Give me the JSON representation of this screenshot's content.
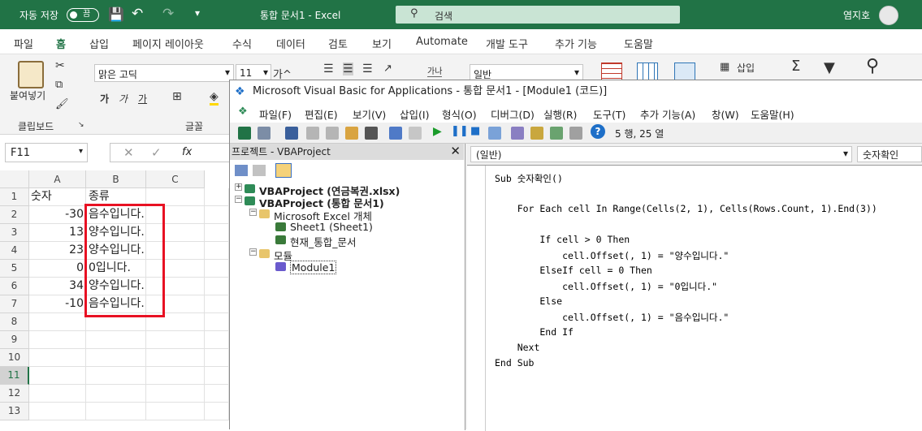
{
  "excel": {
    "autosave_label": "자동 저장",
    "autosave_state": "끔",
    "window_title": "통합 문서1  -  Excel",
    "search_placeholder": "검색",
    "user_name": "염지호",
    "tabs": [
      "파일",
      "홈",
      "삽입",
      "페이지 레이아웃",
      "수식",
      "데이터",
      "검토",
      "보기",
      "Automate",
      "개발 도구",
      "추가 기능",
      "도움말"
    ],
    "active_tab": "홈",
    "ribbon": {
      "paste_label": "붙여넣기",
      "clipboard_group": "클립보드",
      "font_name": "맑은 고딕",
      "font_size": "11",
      "font_group": "글꼴",
      "number_format": "일반",
      "insert_label": "삽입",
      "bold": "가",
      "italic": "가",
      "underline": "가",
      "grow_font": "가^",
      "wrap": "가나"
    },
    "name_box": "F11",
    "formula_fx": "fx",
    "columns": [
      "A",
      "B",
      "C"
    ],
    "rows": [
      {
        "n": "1",
        "a": "숫자",
        "b": "종류"
      },
      {
        "n": "2",
        "a": "-30",
        "b": "음수입니다."
      },
      {
        "n": "3",
        "a": "13",
        "b": "양수입니다."
      },
      {
        "n": "4",
        "a": "23",
        "b": "양수입니다."
      },
      {
        "n": "5",
        "a": "0",
        "b": "0입니다."
      },
      {
        "n": "6",
        "a": "34",
        "b": "양수입니다."
      },
      {
        "n": "7",
        "a": "-10",
        "b": "음수입니다."
      },
      {
        "n": "8",
        "a": "",
        "b": ""
      },
      {
        "n": "9",
        "a": "",
        "b": ""
      },
      {
        "n": "10",
        "a": "",
        "b": ""
      },
      {
        "n": "11",
        "a": "",
        "b": ""
      },
      {
        "n": "12",
        "a": "",
        "b": ""
      },
      {
        "n": "13",
        "a": "",
        "b": ""
      }
    ],
    "selected_row": "11"
  },
  "vbe": {
    "title": "Microsoft Visual Basic for Applications - 통합 문서1 - [Module1 (코드)]",
    "menus": [
      "파일(F)",
      "편집(E)",
      "보기(V)",
      "삽입(I)",
      "형식(O)",
      "디버그(D)",
      "실행(R)",
      "도구(T)",
      "추가 기능(A)",
      "창(W)",
      "도움말(H)"
    ],
    "position": "5 행, 25 열",
    "project_title": "프로젝트 - VBAProject",
    "tree": [
      {
        "label": "VBAProject (연금복권.xlsx)",
        "bold": true
      },
      {
        "label": "VBAProject (통합 문서1)",
        "bold": true
      },
      {
        "label": "Microsoft Excel 개체",
        "bold": false
      },
      {
        "label": "Sheet1 (Sheet1)",
        "bold": false
      },
      {
        "label": "현재_통합_문서",
        "bold": false
      },
      {
        "label": "모듈",
        "bold": false
      },
      {
        "label": "Module1",
        "bold": false
      }
    ],
    "object_combo": "(일반)",
    "proc_combo": "숫자확인",
    "code": [
      "Sub 숫자확인()",
      "",
      "    For Each cell In Range(Cells(2, 1), Cells(Rows.Count, 1).End(3))",
      "",
      "        If cell > 0 Then",
      "            cell.Offset(, 1) = \"양수입니다.\"",
      "        ElseIf cell = 0 Then",
      "            cell.Offset(, 1) = \"0입니다.\"",
      "        Else",
      "            cell.Offset(, 1) = \"음수입니다.\"",
      "        End If",
      "    Next",
      "End Sub"
    ]
  },
  "colors": {
    "excel_green": "#217346",
    "highlight_red": "#e81123"
  }
}
